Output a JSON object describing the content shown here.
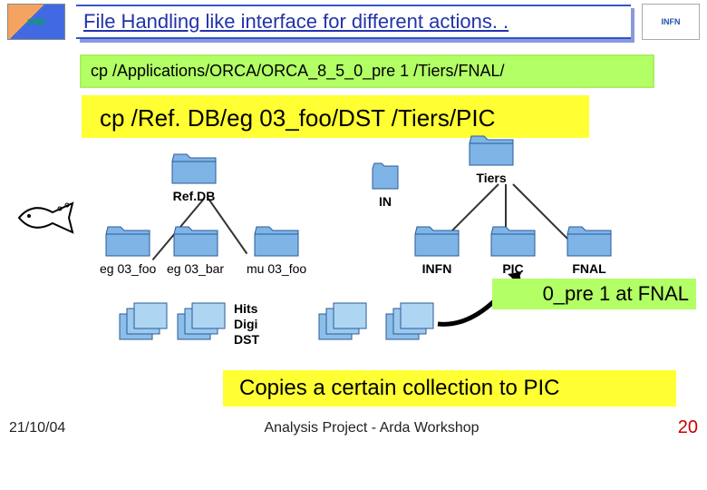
{
  "header": {
    "logo_left": "CMS",
    "logo_right": "INFN",
    "title": "File Handling like interface for different actions. ."
  },
  "cmd_bar": "cp /Applications/ORCA/ORCA_8_5_0_pre 1 /Tiers/FNAL/",
  "big_yellow": "cp /Ref. DB/eg 03_foo/DST /Tiers/PIC",
  "folders": {
    "refdb": "Ref.DB",
    "eg03_foo": "eg 03_foo",
    "eg03_bar": "eg 03_bar",
    "mu03_foo": "mu 03_foo",
    "tiers": "Tiers",
    "infn": "INFN",
    "pic": "PIC",
    "fnal": "FNAL",
    "in_partial": "IN"
  },
  "stack_labels": {
    "hits": "Hits",
    "digi": "Digi",
    "dst": "DST"
  },
  "right_strip": "0_pre 1 at FNAL",
  "caption": "Copies a certain collection to PIC",
  "footer": {
    "date": "21/10/04",
    "center": "Analysis Project - Arda Workshop",
    "page": "20"
  }
}
